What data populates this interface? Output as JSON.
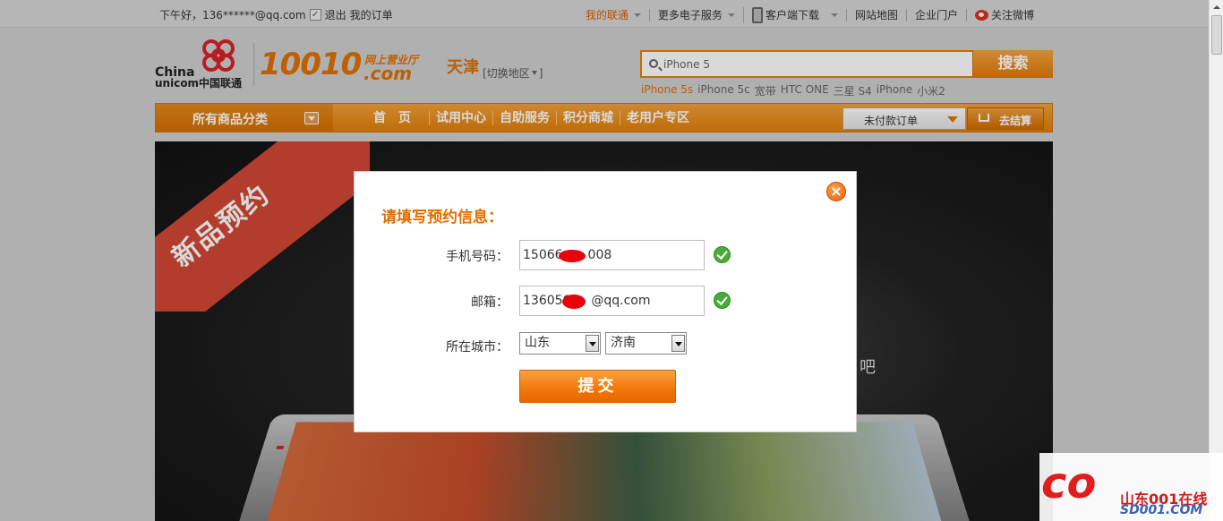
{
  "topbar": {
    "greeting": "下午好，136******@qq.com",
    "logout": "退出",
    "my_orders": "我的订单",
    "links": [
      "我的联通",
      "更多电子服务",
      "客户端下载",
      "网站地图",
      "企业门户",
      "关注微博"
    ]
  },
  "header": {
    "logo_china": "China",
    "logo_unicom": "unicom中国联通",
    "brand_number": "10010",
    "brand_sub": "网上营业厅",
    "brand_com": ".com",
    "city": "天津",
    "city_switch": "[切换地区"
  },
  "search": {
    "value": "iPhone 5",
    "button": "搜索",
    "hotwords": [
      "iPhone 5s",
      "iPhone 5c",
      "宽带",
      "HTC ONE",
      "三星 S4",
      "iPhone",
      "小米2"
    ]
  },
  "nav": {
    "all_categories": "所有商品分类",
    "links": [
      "首　页",
      "试用中心",
      "自助服务",
      "积分商城",
      "老用户专区"
    ],
    "unpaid_orders": "未付款订单",
    "checkout": "去结算"
  },
  "banner": {
    "ribbon": "新品预约",
    "text": "吧"
  },
  "modal": {
    "title": "请填写预约信息：",
    "phone_label": "手机号码：",
    "phone_value": "15066　　008",
    "email_label": "邮箱：",
    "email_value": "1360565　@qq.com",
    "city_label": "所在城市：",
    "province": "山东",
    "city": "济南",
    "submit": "提交",
    "close": "×"
  },
  "watermark": {
    "logo": "co",
    "name": "山东001在线",
    "site": "SD001.COM"
  },
  "colors": {
    "accent": "#e58100",
    "title": "#e36d00",
    "ok": "#4bab3a"
  }
}
